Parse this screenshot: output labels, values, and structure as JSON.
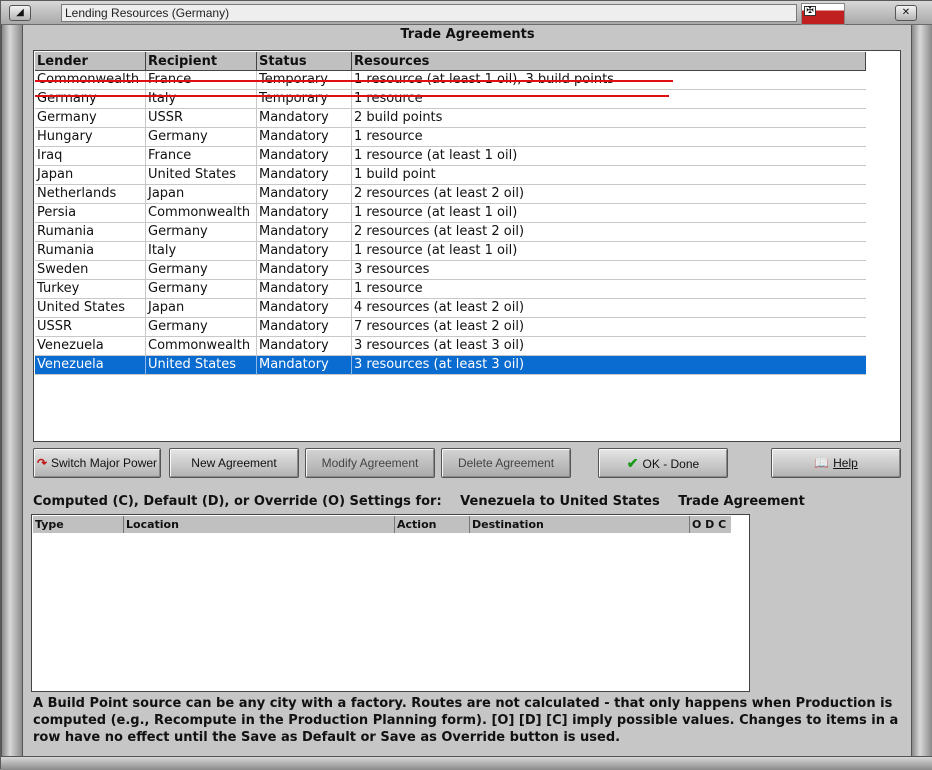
{
  "window": {
    "title": "Lending Resources (Germany)",
    "flag_symbol": "✠",
    "restore_glyph": "◢",
    "close_glyph": "✕"
  },
  "section_title": "Trade Agreements",
  "table": {
    "columns": [
      "Lender",
      "Recipient",
      "Status",
      "Resources"
    ],
    "rows": [
      {
        "lender": "Commonwealth",
        "recipient": "France",
        "status": "Temporary",
        "resources": "1 resource (at least 1 oil), 3 build points"
      },
      {
        "lender": "Germany",
        "recipient": "Italy",
        "status": "Temporary",
        "resources": "1 resource"
      },
      {
        "lender": "Germany",
        "recipient": "USSR",
        "status": "Mandatory",
        "resources": "2 build points"
      },
      {
        "lender": "Hungary",
        "recipient": "Germany",
        "status": "Mandatory",
        "resources": "1 resource"
      },
      {
        "lender": "Iraq",
        "recipient": "France",
        "status": "Mandatory",
        "resources": "1 resource (at least 1 oil)"
      },
      {
        "lender": "Japan",
        "recipient": "United States",
        "status": "Mandatory",
        "resources": "1 build point"
      },
      {
        "lender": "Netherlands",
        "recipient": "Japan",
        "status": "Mandatory",
        "resources": "2 resources (at least 2 oil)"
      },
      {
        "lender": "Persia",
        "recipient": "Commonwealth",
        "status": "Mandatory",
        "resources": "1 resource (at least 1 oil)"
      },
      {
        "lender": "Rumania",
        "recipient": "Germany",
        "status": "Mandatory",
        "resources": "2 resources (at least 2 oil)"
      },
      {
        "lender": "Rumania",
        "recipient": "Italy",
        "status": "Mandatory",
        "resources": "1 resource (at least 1 oil)"
      },
      {
        "lender": "Sweden",
        "recipient": "Germany",
        "status": "Mandatory",
        "resources": "3 resources"
      },
      {
        "lender": "Turkey",
        "recipient": "Germany",
        "status": "Mandatory",
        "resources": "1 resource"
      },
      {
        "lender": "United States",
        "recipient": "Japan",
        "status": "Mandatory",
        "resources": "4 resources (at least 2 oil)"
      },
      {
        "lender": "USSR",
        "recipient": "Germany",
        "status": "Mandatory",
        "resources": "7 resources (at least 2 oil)"
      },
      {
        "lender": "Venezuela",
        "recipient": "Commonwealth",
        "status": "Mandatory",
        "resources": "3 resources (at least 3 oil)"
      },
      {
        "lender": "Venezuela",
        "recipient": "United States",
        "status": "Mandatory",
        "resources": "3 resources (at least 3 oil)"
      }
    ],
    "selected_index": 15,
    "strikethrough_color": "#e01010"
  },
  "buttons": {
    "switch_major_power": "Switch Major Power",
    "switch_icon": "↷",
    "new_agreement": "New Agreement",
    "modify_agreement": "Modify Agreement",
    "delete_agreement": "Delete Agreement",
    "ok_done": "OK - Done",
    "ok_icon": "✔",
    "help": "Help",
    "help_icon": "📖"
  },
  "settings": {
    "label": "Computed (C), Default (D), or Override (O) Settings for:",
    "route": "Venezuela to United States",
    "kind": "Trade Agreement",
    "columns": [
      "Type",
      "Location",
      "Action",
      "Destination",
      "O D C"
    ]
  },
  "footer": "A Build Point source can be any city with a factory. Routes are not calculated - that only happens when Production is computed (e.g., Recompute in the Production Planning form).  [O] [D] [C] imply possible values.  Changes to items in a row have no effect until the Save as Default or Save as Override button is used.",
  "colors": {
    "selection": "#0a6bd0",
    "ok_check": "#1a9a1a",
    "switch_arrow": "#c01818",
    "help_book": "#6a2a8a"
  }
}
